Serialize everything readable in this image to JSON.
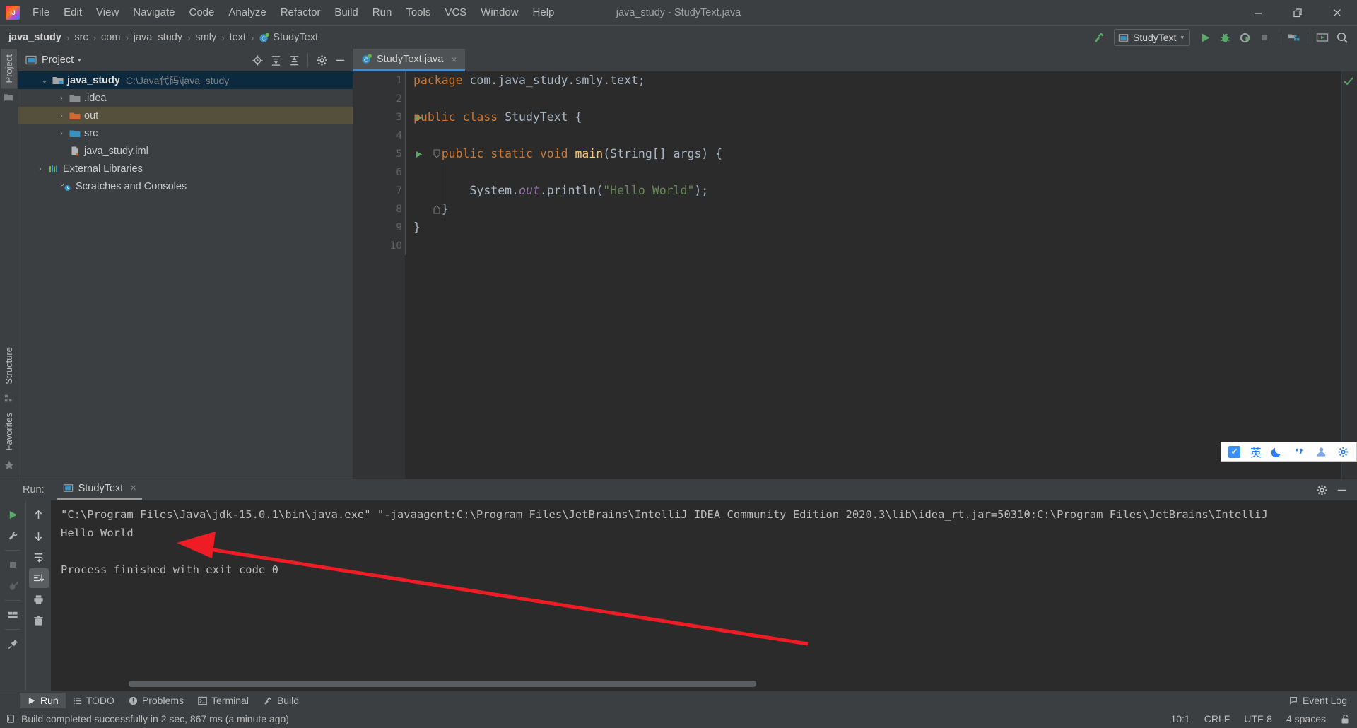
{
  "window": {
    "title": "java_study - StudyText.java",
    "minimize_label": "—",
    "maximize_label": "❐",
    "close_label": "✕"
  },
  "menubar": {
    "items": [
      {
        "label": "File"
      },
      {
        "label": "Edit"
      },
      {
        "label": "View"
      },
      {
        "label": "Navigate"
      },
      {
        "label": "Code"
      },
      {
        "label": "Analyze"
      },
      {
        "label": "Refactor"
      },
      {
        "label": "Build"
      },
      {
        "label": "Run"
      },
      {
        "label": "Tools"
      },
      {
        "label": "VCS"
      },
      {
        "label": "Window"
      },
      {
        "label": "Help"
      }
    ]
  },
  "navbar": {
    "breadcrumbs": [
      "java_study",
      "src",
      "com",
      "java_study",
      "smly",
      "text"
    ],
    "class_name": "StudyText",
    "separator": "›"
  },
  "toolbar": {
    "build_tooltip": "Build",
    "run_config": "StudyText",
    "run_config_caret": "▾",
    "run_label": "Run",
    "debug_label": "Debug",
    "run_coverage_label": "Run with Coverage",
    "stop_label": "Stop",
    "project_structure_label": "Project Structure",
    "updates_label": "Updates",
    "search_label": "Search Everywhere"
  },
  "left_strip": {
    "project_tab": "Project",
    "structure_tab": "Structure",
    "favorites_tab": "Favorites"
  },
  "project_panel": {
    "title": "Project",
    "caret": "▾",
    "icons": [
      "locate-icon",
      "expand-all-icon",
      "collapse-all-icon",
      "settings-icon",
      "hide-icon"
    ],
    "tree": [
      {
        "indent": 0,
        "arrow": "⌄",
        "icon": "module-folder",
        "label": "java_study",
        "bold": true,
        "sub": "C:\\Java代码\\java_study",
        "state": "selected"
      },
      {
        "indent": 1,
        "arrow": "›",
        "icon": "folder-grey",
        "label": ".idea",
        "bold": false,
        "sub": "",
        "state": "normal"
      },
      {
        "indent": 1,
        "arrow": "›",
        "icon": "folder-orange",
        "label": "out",
        "bold": false,
        "sub": "",
        "state": "highlight"
      },
      {
        "indent": 1,
        "arrow": "›",
        "icon": "folder-blue",
        "label": "src",
        "bold": false,
        "sub": "",
        "state": "normal"
      },
      {
        "indent": 1,
        "arrow": "",
        "icon": "iml-file",
        "label": "java_study.iml",
        "bold": false,
        "sub": "",
        "state": "normal"
      },
      {
        "indent": 0,
        "arrow": "›",
        "icon": "libraries",
        "label": "External Libraries",
        "bold": false,
        "sub": "",
        "state": "normal"
      },
      {
        "indent": 0,
        "arrow": "",
        "icon": "scratches",
        "label": "Scratches and Consoles",
        "bold": false,
        "sub": "",
        "state": "normal"
      }
    ]
  },
  "editor": {
    "tab_label": "StudyText.java",
    "tab_close": "×",
    "line_numbers": [
      "1",
      "2",
      "3",
      "4",
      "5",
      "6",
      "7",
      "8",
      "9",
      "10"
    ],
    "code_lines": [
      {
        "n": 1,
        "tokens": [
          {
            "t": "package ",
            "c": "k"
          },
          {
            "t": "com.java_study.smly.text;",
            "c": "id"
          }
        ]
      },
      {
        "n": 2,
        "tokens": []
      },
      {
        "n": 3,
        "gutter": "run-arrow",
        "tokens": [
          {
            "t": "public class ",
            "c": "k"
          },
          {
            "t": "StudyText ",
            "c": "id"
          },
          {
            "t": "{",
            "c": "pn"
          }
        ]
      },
      {
        "n": 4,
        "tokens": []
      },
      {
        "n": 5,
        "gutter": "run-arrow",
        "fold": "start",
        "tokens": [
          {
            "t": "    public static void ",
            "c": "k"
          },
          {
            "t": "main",
            "c": "fn"
          },
          {
            "t": "(String[] args) {",
            "c": "id"
          }
        ]
      },
      {
        "n": 6,
        "tokens": []
      },
      {
        "n": 7,
        "tokens": [
          {
            "t": "        System.",
            "c": "id"
          },
          {
            "t": "out",
            "c": "fs"
          },
          {
            "t": ".println(",
            "c": "id"
          },
          {
            "t": "\"Hello World\"",
            "c": "st"
          },
          {
            "t": ");",
            "c": "id"
          }
        ]
      },
      {
        "n": 8,
        "fold": "end",
        "tokens": [
          {
            "t": "    }",
            "c": "pn"
          }
        ]
      },
      {
        "n": 9,
        "tokens": [
          {
            "t": "}",
            "c": "pn"
          }
        ]
      },
      {
        "n": 10,
        "tokens": []
      }
    ],
    "inspection_status": "ok"
  },
  "ime_bar": {
    "checkbox_glyph": "✔",
    "lang_label": "英",
    "moon_label": "moon-icon",
    "punct_label": "punctuation-icon",
    "user_label": "user-icon",
    "settings_label": "settings-icon"
  },
  "run_panel": {
    "label": "Run:",
    "tab_label": "StudyText",
    "tab_close": "×",
    "settings_icon": "settings-icon",
    "hide_icon": "hide-icon",
    "left_tools": [
      "rerun-icon",
      "wrench-icon",
      "stop-icon",
      "dump-threads-icon",
      "layout-icon",
      "pin-icon"
    ],
    "right_tools": [
      "up-icon",
      "down-icon",
      "soft-wrap-icon",
      "scroll-to-end-icon",
      "print-icon",
      "trash-icon"
    ],
    "console_lines": [
      "\"C:\\Program Files\\Java\\jdk-15.0.1\\bin\\java.exe\" \"-javaagent:C:\\Program Files\\JetBrains\\IntelliJ IDEA Community Edition 2020.3\\lib\\idea_rt.jar=50310:C:\\Program Files\\JetBrains\\IntelliJ",
      "Hello World",
      "",
      "Process finished with exit code 0"
    ]
  },
  "tool_window_bar": {
    "items": [
      {
        "label": "Run",
        "icon": "run-icon",
        "active": true
      },
      {
        "label": "TODO",
        "icon": "todo-icon",
        "active": false
      },
      {
        "label": "Problems",
        "icon": "problems-icon",
        "active": false
      },
      {
        "label": "Terminal",
        "icon": "terminal-icon",
        "active": false
      },
      {
        "label": "Build",
        "icon": "build-icon",
        "active": false
      }
    ],
    "event_log": "Event Log"
  },
  "status_bar": {
    "message": "Build completed successfully in 2 sec, 867 ms (a minute ago)",
    "caret_position": "10:1",
    "line_separator": "CRLF",
    "encoding": "UTF-8",
    "indent": "4 spaces",
    "lock_icon": "lock-icon"
  },
  "colors": {
    "bg_chrome": "#3c3f41",
    "bg_editor": "#2b2b2b",
    "accent_blue": "#4a88c7",
    "accent_green": "#499c54",
    "selection": "#0d293e",
    "highlight": "#55503c",
    "annotation_red": "#ee1c25"
  }
}
